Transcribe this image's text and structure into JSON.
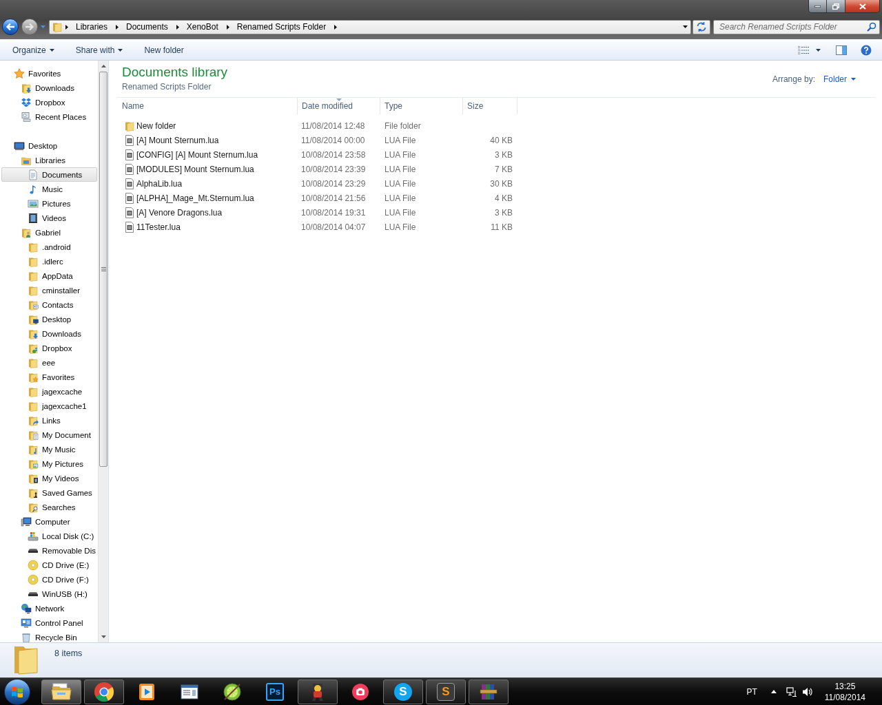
{
  "navigation": {
    "back": {
      "disabled": false
    },
    "forward": {
      "disabled": true
    }
  },
  "address_bar": {
    "crumbs": [
      "Libraries",
      "Documents",
      "XenoBot",
      "Renamed Scripts Folder"
    ]
  },
  "search": {
    "placeholder": "Search Renamed Scripts Folder"
  },
  "toolbar": {
    "items": [
      {
        "label": "Organize",
        "dropdown": true
      },
      {
        "label": "Share with",
        "dropdown": true
      },
      {
        "label": "New folder",
        "dropdown": false
      }
    ]
  },
  "sidebar": {
    "items": [
      {
        "label": "Favorites",
        "kind": "star",
        "selected": false,
        "children": [
          {
            "label": "Downloads",
            "kind": "folder-download",
            "selected": false
          },
          {
            "label": "Dropbox",
            "kind": "dropbox",
            "selected": false
          },
          {
            "label": "Recent Places",
            "kind": "recent",
            "selected": false
          }
        ]
      },
      {
        "label": "Desktop",
        "kind": "desktop",
        "selected": false,
        "children": [
          {
            "label": "Libraries",
            "kind": "library",
            "selected": false,
            "children": [
              {
                "label": "Documents",
                "kind": "document",
                "selected": true
              },
              {
                "label": "Music",
                "kind": "music",
                "selected": false
              },
              {
                "label": "Pictures",
                "kind": "picture",
                "selected": false
              },
              {
                "label": "Videos",
                "kind": "video",
                "selected": false
              }
            ]
          },
          {
            "label": "Gabriel",
            "kind": "user",
            "selected": false,
            "children": [
              {
                "label": ".android",
                "kind": "folder",
                "selected": false
              },
              {
                "label": ".idlerc",
                "kind": "folder",
                "selected": false
              },
              {
                "label": "AppData",
                "kind": "folder",
                "selected": false
              },
              {
                "label": "cminstaller",
                "kind": "folder",
                "selected": false
              },
              {
                "label": "Contacts",
                "kind": "folder-contacts",
                "selected": false
              },
              {
                "label": "Desktop",
                "kind": "folder-desktop",
                "selected": false
              },
              {
                "label": "Downloads",
                "kind": "folder-download",
                "selected": false
              },
              {
                "label": "Dropbox",
                "kind": "folder-dropbox",
                "selected": false
              },
              {
                "label": "eee",
                "kind": "folder",
                "selected": false
              },
              {
                "label": "Favorites",
                "kind": "folder-star",
                "selected": false
              },
              {
                "label": "jagexcache",
                "kind": "folder",
                "selected": false
              },
              {
                "label": "jagexcache1",
                "kind": "folder",
                "selected": false
              },
              {
                "label": "Links",
                "kind": "folder-link",
                "selected": false
              },
              {
                "label": "My Document",
                "kind": "folder-document",
                "selected": false
              },
              {
                "label": "My Music",
                "kind": "folder-music",
                "selected": false
              },
              {
                "label": "My Pictures",
                "kind": "folder-picture",
                "selected": false
              },
              {
                "label": "My Videos",
                "kind": "folder-video",
                "selected": false
              },
              {
                "label": "Saved Games",
                "kind": "folder-games",
                "selected": false
              },
              {
                "label": "Searches",
                "kind": "folder-search",
                "selected": false
              }
            ]
          },
          {
            "label": "Computer",
            "kind": "computer",
            "selected": false,
            "children": [
              {
                "label": "Local Disk (C:)",
                "kind": "disk",
                "selected": false
              },
              {
                "label": "Removable Dis",
                "kind": "removable",
                "selected": false
              },
              {
                "label": "CD Drive (E:)",
                "kind": "cd",
                "selected": false
              },
              {
                "label": "CD Drive (F:)",
                "kind": "cd",
                "selected": false
              },
              {
                "label": "WinUSB (H:)",
                "kind": "removable",
                "selected": false
              }
            ]
          },
          {
            "label": "Network",
            "kind": "network",
            "selected": false
          },
          {
            "label": "Control Panel",
            "kind": "control-panel",
            "selected": false
          },
          {
            "label": "Recycle Bin",
            "kind": "recycle-bin",
            "selected": false
          }
        ]
      }
    ]
  },
  "library": {
    "title": "Documents library",
    "subtitle": "Renamed Scripts Folder",
    "arrange_label": "Arrange by:",
    "arrange_value": "Folder"
  },
  "file_list": {
    "columns": [
      {
        "label": "Name",
        "sorted": false
      },
      {
        "label": "Date modified",
        "sorted": true
      },
      {
        "label": "Type",
        "sorted": false
      },
      {
        "label": "Size",
        "sorted": false
      }
    ],
    "rows": [
      {
        "kind": "folder",
        "name": "New folder",
        "date": "11/08/2014 12:48",
        "type": "File folder"
      },
      {
        "kind": "file",
        "name": "[A] Mount Sternum.lua",
        "date": "11/08/2014 00:00",
        "type": "LUA File",
        "size": "40 KB"
      },
      {
        "kind": "file",
        "name": "[CONFIG] [A] Mount Sternum.lua",
        "date": "10/08/2014 23:58",
        "type": "LUA File",
        "size": "3 KB"
      },
      {
        "kind": "file",
        "name": "[MODULES] Mount Sternum.lua",
        "date": "10/08/2014 23:39",
        "type": "LUA File",
        "size": "7 KB"
      },
      {
        "kind": "file",
        "name": "AlphaLib.lua",
        "date": "10/08/2014 23:29",
        "type": "LUA File",
        "size": "30 KB"
      },
      {
        "kind": "file",
        "name": "[ALPHA]_Mage_Mt.Sternum.lua",
        "date": "10/08/2014 21:56",
        "type": "LUA File",
        "size": "4 KB"
      },
      {
        "kind": "file",
        "name": "[A] Venore Dragons.lua",
        "date": "10/08/2014 19:31",
        "type": "LUA File",
        "size": "3 KB"
      },
      {
        "kind": "file",
        "name": "11Tester.lua",
        "date": "10/08/2014 04:07",
        "type": "LUA File",
        "size": "11 KB"
      }
    ]
  },
  "status_bar": {
    "count": "8 items"
  },
  "taskbar": {
    "apps": [
      {
        "kind": "explorer",
        "running": true,
        "active": true
      },
      {
        "kind": "chrome",
        "running": true,
        "active": false
      },
      {
        "kind": "media",
        "running": false,
        "active": false
      },
      {
        "kind": "window",
        "running": false,
        "active": false
      },
      {
        "kind": "lime",
        "running": false,
        "active": false
      },
      {
        "kind": "photoshop",
        "glyph": "Ps",
        "running": false,
        "active": false
      },
      {
        "kind": "character",
        "running": true,
        "active": false
      },
      {
        "kind": "camera",
        "running": false,
        "active": false
      },
      {
        "kind": "skype",
        "glyph": "S",
        "running": true,
        "active": false
      },
      {
        "kind": "sublime",
        "glyph": "S",
        "running": true,
        "active": false
      },
      {
        "kind": "archive",
        "running": true,
        "active": false
      }
    ],
    "tray": {
      "language": "PT",
      "time": "13:25",
      "date": "11/08/2014"
    }
  }
}
